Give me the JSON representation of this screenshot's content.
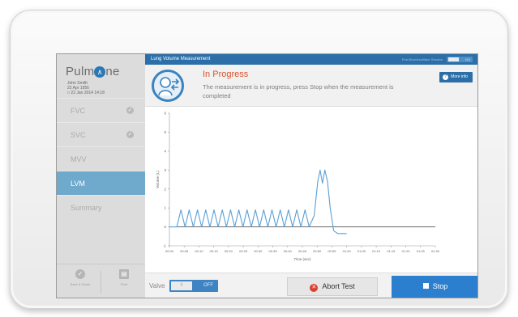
{
  "app": {
    "logo_text": "Pulm",
    "logo_mark": "∧",
    "logo_suffix": "ne"
  },
  "patient": {
    "name": "John Smith",
    "dob": "22 Apr 1956",
    "session": "22 Jan 2014 14:18"
  },
  "sidebar": {
    "items": [
      {
        "label": "FVC",
        "badge": "✓"
      },
      {
        "label": "SVC",
        "badge": "✓"
      },
      {
        "label": "MVV",
        "badge": ""
      },
      {
        "label": "LVM",
        "badge": ""
      },
      {
        "label": "Summary",
        "badge": ""
      }
    ],
    "active_index": 3,
    "save_label": "Save & Finish",
    "print_label": "Print"
  },
  "titlebar": {
    "title": "Lung Volume Measurement",
    "post_label": "Post Bronchodilator Session",
    "toggle_label": "NO"
  },
  "status": {
    "title": "In Progress",
    "message": "The measurement is in progress, press Stop when the measurement is completed",
    "more_info_label": "More info"
  },
  "controls": {
    "valve_label": "Valve",
    "valve_on_label": "II",
    "valve_off_label": "OFF",
    "abort_label": "Abort Test",
    "stop_label": "Stop"
  },
  "colors": {
    "accent": "#2c6fa8",
    "active_nav": "#6fa9cc",
    "status_title": "#d9532c",
    "abort_icon": "#d9412f",
    "trace": "#5aa0d6"
  },
  "chart_data": {
    "type": "line",
    "ylabel": "Volume (L)",
    "xlabel": "Time (sec)",
    "ylim": [
      -1,
      6
    ],
    "yticks": [
      "-1",
      "0",
      "1",
      "2",
      "3",
      "4",
      "5",
      "6"
    ],
    "xticks": [
      "00:00",
      "00:05",
      "00:10",
      "00:15",
      "00:20",
      "00:25",
      "00:30",
      "00:35",
      "00:40",
      "00:45",
      "00:50",
      "00:55",
      "01:00",
      "01:05",
      "01:10",
      "01:15",
      "01:20",
      "01:25",
      "01:30"
    ],
    "xlim": [
      0,
      90
    ],
    "series": [
      {
        "values": [
          [
            0,
            0
          ],
          [
            2.5,
            0
          ],
          [
            3.9,
            0.9
          ],
          [
            5.3,
            0
          ],
          [
            6.7,
            0.9
          ],
          [
            8.1,
            0
          ],
          [
            9.5,
            0.9
          ],
          [
            10.9,
            0
          ],
          [
            12.3,
            0.9
          ],
          [
            13.7,
            0
          ],
          [
            15.1,
            0.9
          ],
          [
            16.5,
            0
          ],
          [
            17.9,
            0.9
          ],
          [
            19.3,
            0
          ],
          [
            20.7,
            0.9
          ],
          [
            22.1,
            0
          ],
          [
            23.5,
            0.9
          ],
          [
            24.9,
            0
          ],
          [
            26.3,
            0.9
          ],
          [
            27.7,
            0
          ],
          [
            29.1,
            0.9
          ],
          [
            30.5,
            0
          ],
          [
            31.9,
            0.9
          ],
          [
            33.3,
            0
          ],
          [
            34.7,
            0.9
          ],
          [
            36.1,
            0
          ],
          [
            37.5,
            0.9
          ],
          [
            38.9,
            0
          ],
          [
            40.3,
            0.9
          ],
          [
            41.7,
            0
          ],
          [
            43.1,
            0.9
          ],
          [
            44.5,
            0
          ],
          [
            45.9,
            0.9
          ],
          [
            47.3,
            0
          ],
          [
            49.0,
            0.6
          ],
          [
            50.2,
            2.4
          ],
          [
            51.0,
            3.0
          ],
          [
            51.8,
            2.3
          ],
          [
            52.6,
            3.0
          ],
          [
            53.5,
            2.4
          ],
          [
            54.4,
            1.0
          ],
          [
            55.6,
            -0.2
          ],
          [
            57.0,
            -0.35
          ],
          [
            60.0,
            -0.35
          ]
        ]
      }
    ],
    "baseline": 0
  }
}
